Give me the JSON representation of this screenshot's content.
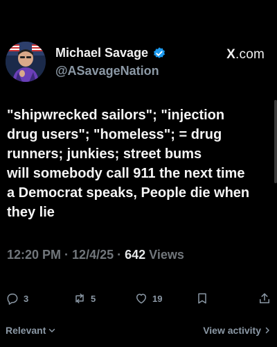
{
  "author": {
    "name": "Michael Savage",
    "handle": "@ASavageNation",
    "verified_color": "#1d9bf0"
  },
  "brand": {
    "logo": "X",
    "suffix": ".com"
  },
  "post": {
    "lines": [
      "\"shipwrecked sailors\"; \"injection",
      "drug users\";  \"homeless\"; = drug",
      "runners; junkies; street bums",
      "will somebody call 911 the next time",
      "a Democrat speaks, People die when",
      "they lie"
    ]
  },
  "meta": {
    "time": "12:20 PM",
    "sep1": " · ",
    "date": "12/4/25",
    "sep2": " · ",
    "views_count": "642",
    "views_label": " Views"
  },
  "actions": {
    "replies": {
      "icon": "reply-icon",
      "count": "3"
    },
    "reposts": {
      "icon": "repost-icon",
      "count": "5"
    },
    "likes": {
      "icon": "heart-icon",
      "count": "19"
    },
    "bookmark": {
      "icon": "bookmark-icon"
    },
    "share": {
      "icon": "share-icon"
    }
  },
  "footer": {
    "relevant_label": "Relevant",
    "activity_label": "View activity"
  }
}
